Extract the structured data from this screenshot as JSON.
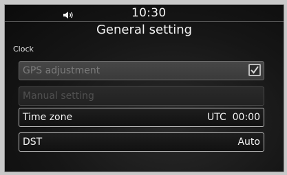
{
  "status_bar": {
    "volume_icon": "speaker-icon",
    "time": "10:30"
  },
  "header": {
    "title": "General setting"
  },
  "section": {
    "label": "Clock"
  },
  "settings": {
    "gps_adjustment": {
      "label": "GPS adjustment",
      "checked": true,
      "enabled": false
    },
    "manual_setting": {
      "label": "Manual setting",
      "enabled": false
    },
    "time_zone": {
      "label": "Time zone",
      "value_prefix": "UTC",
      "value": "00:00"
    },
    "dst": {
      "label": "DST",
      "value": "Auto"
    }
  },
  "colors": {
    "text": "#f4f4f4",
    "row_border": "#bdbdbd",
    "disabled_text": "#7b7b7b"
  }
}
